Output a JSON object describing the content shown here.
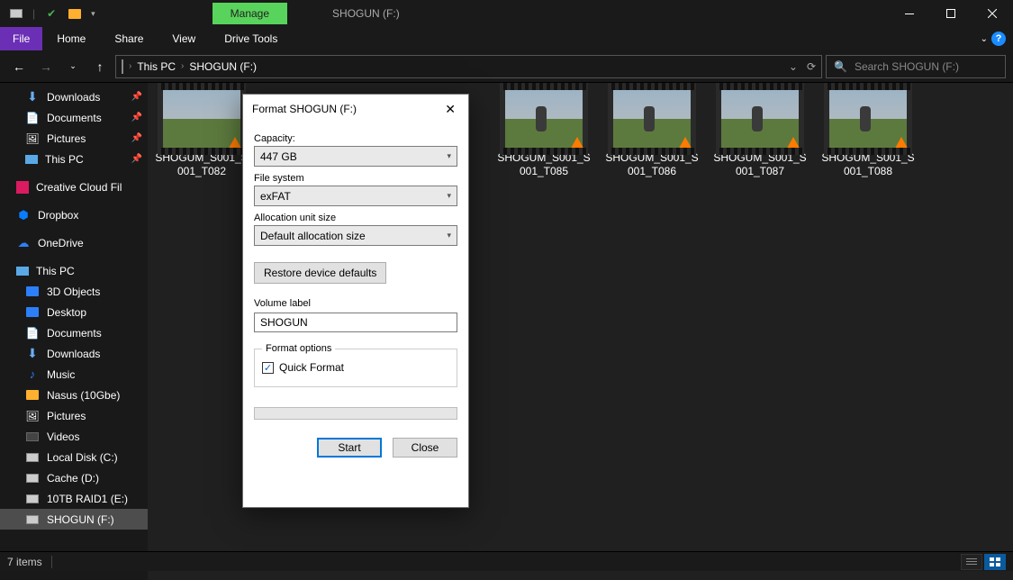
{
  "window": {
    "manage_tab": "Manage",
    "title": "SHOGUN (F:)"
  },
  "ribbon": {
    "file": "File",
    "tabs": [
      "Home",
      "Share",
      "View",
      "Drive Tools"
    ]
  },
  "breadcrumb": {
    "root": "This PC",
    "current": "SHOGUN (F:)"
  },
  "search": {
    "placeholder": "Search SHOGUN (F:)"
  },
  "sidebar": {
    "quick": [
      {
        "label": "Downloads",
        "icon": "downarrow",
        "pin": true
      },
      {
        "label": "Documents",
        "icon": "doc",
        "pin": true
      },
      {
        "label": "Pictures",
        "icon": "pic",
        "pin": true
      },
      {
        "label": "This PC",
        "icon": "pc",
        "pin": true
      }
    ],
    "cc": "Creative Cloud Fil",
    "dropbox": "Dropbox",
    "onedrive": "OneDrive",
    "thispc": "This PC",
    "thispc_children": [
      {
        "label": "3D Objects",
        "icon": "blue"
      },
      {
        "label": "Desktop",
        "icon": "blue"
      },
      {
        "label": "Documents",
        "icon": "doc"
      },
      {
        "label": "Downloads",
        "icon": "downarrow"
      },
      {
        "label": "Music",
        "icon": "music"
      },
      {
        "label": "Nasus (10Gbe)",
        "icon": "folder"
      },
      {
        "label": "Pictures",
        "icon": "pic"
      },
      {
        "label": "Videos",
        "icon": "video"
      },
      {
        "label": "Local Disk (C:)",
        "icon": "drive"
      },
      {
        "label": "Cache (D:)",
        "icon": "drive"
      },
      {
        "label": "10TB RAID1 (E:)",
        "icon": "drive"
      },
      {
        "label": "SHOGUN (F:)",
        "icon": "drive",
        "sel": true
      }
    ]
  },
  "files": [
    {
      "name": "SHOGUM_S001_S001_T082"
    },
    {
      "name": "SHOGUM_S001_S001_T085"
    },
    {
      "name": "SHOGUM_S001_S001_T086"
    },
    {
      "name": "SHOGUM_S001_S001_T087"
    },
    {
      "name": "SHOGUM_S001_S001_T088"
    }
  ],
  "dialog": {
    "title": "Format SHOGUN (F:)",
    "capacity_label": "Capacity:",
    "capacity_value": "447 GB",
    "filesystem_label": "File system",
    "filesystem_value": "exFAT",
    "allocation_label": "Allocation unit size",
    "allocation_value": "Default allocation size",
    "restore_btn": "Restore device defaults",
    "volume_label": "Volume label",
    "volume_value": "SHOGUN",
    "format_options_legend": "Format options",
    "quick_format": "Quick Format",
    "start": "Start",
    "close": "Close"
  },
  "status": {
    "count": "7 items"
  }
}
